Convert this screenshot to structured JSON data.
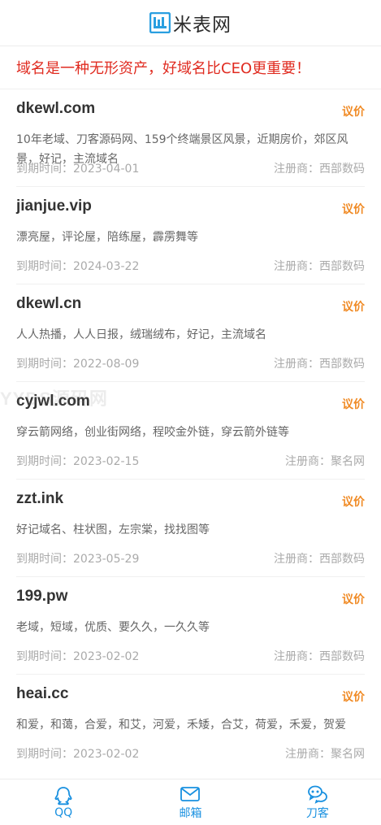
{
  "header": {
    "logo_text": "米表网",
    "logo_icon": "logo-mark-icon"
  },
  "slogan": "域名是一种无形资产，好域名比CEO更重要！",
  "domains": [
    {
      "name": "dkewl.com",
      "offer": "议价",
      "desc": "10年老域、刀客源码网、159个终端景区风景，近期房价，郊区风景，好记，主流域名",
      "expiry_label": "到期时间：",
      "expiry": "2023-04-01",
      "registrar_label": "注册商：",
      "registrar": "西部数码"
    },
    {
      "name": "jianjue.vip",
      "offer": "议价",
      "desc": "漂亮屋，评论屋，陪练屋，霹雳舞等",
      "expiry_label": "到期时间：",
      "expiry": "2024-03-22",
      "registrar_label": "注册商：",
      "registrar": "西部数码"
    },
    {
      "name": "dkewl.cn",
      "offer": "议价",
      "desc": "人人热播，人人日报，绒瑞绒布，好记，主流域名",
      "expiry_label": "到期时间：",
      "expiry": "2022-08-09",
      "registrar_label": "注册商：",
      "registrar": "西部数码"
    },
    {
      "name": "cyjwl.com",
      "offer": "议价",
      "desc": "穿云箭网络，创业街网络，程咬金外链，穿云箭外链等",
      "expiry_label": "到期时间：",
      "expiry": "2023-02-15",
      "registrar_label": "注册商：",
      "registrar": "聚名网"
    },
    {
      "name": "zzt.ink",
      "offer": "议价",
      "desc": "好记域名、柱状图，左宗棠，找找图等",
      "expiry_label": "到期时间：",
      "expiry": "2023-05-29",
      "registrar_label": "注册商：",
      "registrar": "西部数码"
    },
    {
      "name": "199.pw",
      "offer": "议价",
      "desc": "老域，短域，优质、要久久，一久久等",
      "expiry_label": "到期时间：",
      "expiry": "2023-02-02",
      "registrar_label": "注册商：",
      "registrar": "西部数码"
    },
    {
      "name": "heai.cc",
      "offer": "议价",
      "desc": "和爱，和蔼，合爱，和艾，河爱，禾矮，合艾，荷爱，禾爱，贺爱",
      "expiry_label": "到期时间：",
      "expiry": "2023-02-02",
      "registrar_label": "注册商：",
      "registrar": "聚名网"
    }
  ],
  "watermark": "YYDS源码网",
  "tabbar": [
    {
      "label": "QQ",
      "icon": "qq-icon"
    },
    {
      "label": "邮箱",
      "icon": "mail-icon"
    },
    {
      "label": "刀客",
      "icon": "chat-icon"
    }
  ],
  "colors": {
    "accent": "#1890e0",
    "slogan": "#e02b20",
    "offer": "#f08a24"
  }
}
